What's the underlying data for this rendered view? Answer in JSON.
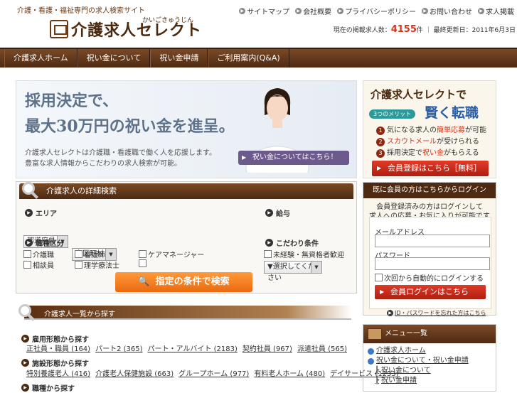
{
  "header": {
    "tagline": "介護・看護・福祉専門の求人検索サイト",
    "logo_text": "介護求人セレクト",
    "logo_ruby": "かいごきゅうじん",
    "top_links": [
      "サイトマップ",
      "会社概要",
      "プライバシーポリシー",
      "お問い合わせ",
      "求人掲載"
    ],
    "count_prefix": "現在の掲載求人数：",
    "count_value": "4155",
    "count_suffix": "件 ｜ 最終更新日：2011年6月3日"
  },
  "nav": {
    "items": [
      "介護求人ホーム",
      "祝い金について",
      "祝い金申請",
      "ご利用案内(Q&A)"
    ]
  },
  "hero": {
    "line1": "採用決定で、",
    "line2": "最大30万円の祝い金を進呈。",
    "desc1": "介護求人セレクトは介護職・看護職で働く人を応援します。",
    "desc2": "豊富な求人情報からこだわりの求人検索が可能。",
    "button": "祝い金についてはこちら！"
  },
  "promo": {
    "title": "介護求人セレクトで",
    "title2": "賢く転職",
    "badge": "3つのメリット",
    "merits": [
      {
        "num": "1",
        "pre": "気になる求人の",
        "hl": "簡単応募",
        "post": "が可能"
      },
      {
        "num": "2",
        "pre": "",
        "hl": "スカウトメール",
        "post": "が受けられる"
      },
      {
        "num": "3",
        "pre": "採用決定で",
        "hl": "祝い金",
        "post": "がもらえる"
      }
    ],
    "register_button": "会員登録はこちら［無料］"
  },
  "search": {
    "title": "介護求人の詳細検索",
    "area_label": "エリア",
    "pref_value": "都道府県",
    "city_value": "市区町村",
    "salary_label": "給与",
    "salary_value": "▼選択してください",
    "job_label": "職種区分",
    "jobs": [
      "介護職",
      "看護師",
      "ケアマネージャー",
      "相談員",
      "理学療法士"
    ],
    "cond_label": "こだわり条件",
    "conds": [
      "未経験・無資格者歓迎"
    ],
    "button": "指定の条件で検索"
  },
  "listing": {
    "title": "介護求人一覧から探す",
    "categories": [
      {
        "label": "雇用形態から探す",
        "links": [
          "正社員・職員 (164)",
          "パート2 (365)",
          "パート・アルバイト (2183)",
          "契約社員 (967)",
          "派遣社員 (565)"
        ]
      },
      {
        "label": "施設形態から探す",
        "links": [
          "特別養護老人 (416)",
          "介護老人保健施設 (663)",
          "グループホーム (977)",
          "有料老人ホーム (480)",
          "デイサービス (1233)"
        ]
      },
      {
        "label": "職種から探す",
        "links": []
      }
    ]
  },
  "login": {
    "title": "既に会員の方はこちらからログイン",
    "note1": "会員登録済みの方はログインして",
    "note2": "求人への応募・お気に入りが可能です",
    "id_label": "メールアドレス",
    "pw_label": "パスワード",
    "remember": "次回から自動的にログインする",
    "button": "会員ログインはこちら",
    "forgot": "ID・パスワードを忘れた方はこちら"
  },
  "sidemenu": {
    "title": "メニュー一覧",
    "items": [
      "介護求人ホーム",
      "祝い金について・祝い金申請",
      "祝い金について",
      "祝い金申請"
    ]
  }
}
